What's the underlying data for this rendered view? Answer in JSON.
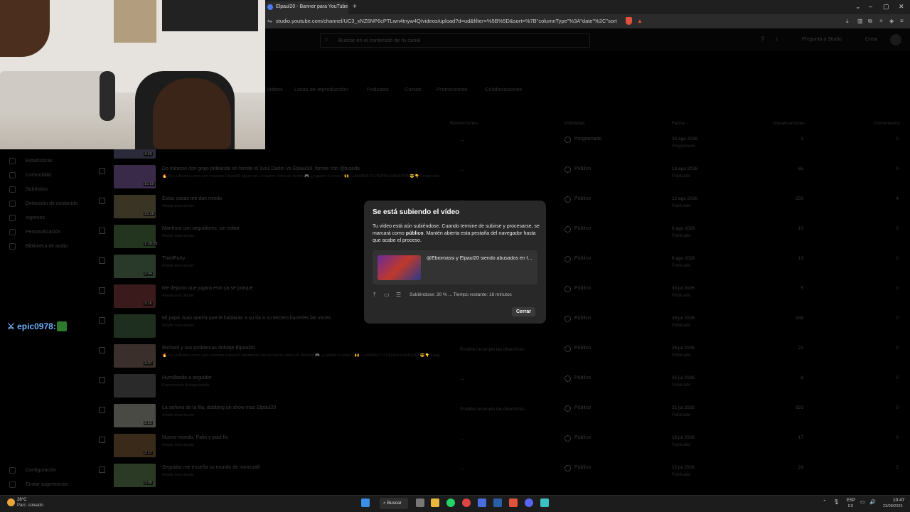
{
  "browser": {
    "tab_title": "Elpaul20 - Banner para YouTube",
    "url": "studio.youtube.com/channel/UC3_xNZ6NP6cPTLwn4tnyw4Q/videos/upload?d=ud&filter=%5B%5D&sort=%7B\"columnType\"%3A\"date\"%2C\"sortOrder\"%...",
    "new_tab": "+",
    "win_min": "–",
    "win_max": "▢",
    "win_close": "✕"
  },
  "studio_header": {
    "search_placeholder": "Buscar en el contenido de tu canal",
    "ask": "Pregunta a Studio",
    "create": "Crear"
  },
  "content_tabs": [
    "Videos",
    "Listas de reproducción",
    "Podcasts",
    "Cursos",
    "Promociones",
    "Colaboraciones"
  ],
  "sidebar": [
    {
      "label": "Estadísticas",
      "icon": "chart-icon"
    },
    {
      "label": "Comunidad",
      "icon": "community-icon"
    },
    {
      "label": "Subtítulos",
      "icon": "subtitles-icon"
    },
    {
      "label": "Detección de contenido",
      "icon": "copyright-icon"
    },
    {
      "label": "Ingresos",
      "icon": "money-icon"
    },
    {
      "label": "Personalización",
      "icon": "customize-icon"
    },
    {
      "label": "Biblioteca de audio",
      "icon": "audio-icon"
    }
  ],
  "sidebar_bottom": [
    {
      "label": "Configuración",
      "icon": "gear-icon"
    },
    {
      "label": "Enviar sugerencias",
      "icon": "feedback-icon"
    }
  ],
  "table_headers": {
    "restrictions": "Restricciones",
    "visibility": "Visibilidad",
    "date": "Fecha ↓",
    "views": "Visualizaciones",
    "comments": "Comentarios"
  },
  "rows": [
    {
      "title": "",
      "desc": "",
      "duration": "4:29",
      "restr": "—",
      "vis": "Programado",
      "date": "24 ago 2026",
      "status": "Programado",
      "views": "1",
      "comments": "0"
    },
    {
      "title": "Do minecio con grajo peleando en fornite el 1vs1 Darlin Vs Elpaul20, fornite con @tuzeda",
      "desc": "🔥 M-y-x Bueno como son vosotros Elpaul20 sigue con un nuevo vídeo de fornite 🎮 ¿y guzito e vosos? 🙌 LLAMADA TU PERRA HAVIERTA 😎👇 Luego esto más de juegos y secretos que se están buscando en. Vosotros no 👇",
      "duration": "10:59",
      "restr": "—",
      "vis": "Público",
      "date": "13 ago 2026",
      "status": "Publicado",
      "views": "65",
      "comments": "0"
    },
    {
      "title": "Estas casas me dan miedo",
      "desc": "Añadir descripción",
      "duration": "23:28",
      "restr": "—",
      "vis": "Público",
      "date": "12 ago 2026",
      "status": "Publicado",
      "views": "250",
      "comments": "4"
    },
    {
      "title": "Manhunt con seguidores, sin editar",
      "desc": "Añadir descripción",
      "duration": "1:28:25",
      "restr": "—",
      "vis": "Público",
      "date": "6 ago 2026",
      "status": "Publicado",
      "views": "10",
      "comments": "0"
    },
    {
      "title": "ThirdParty",
      "desc": "Añadir descripción",
      "duration": "2:04",
      "restr": "—",
      "vis": "Público",
      "date": "6 ago 2026",
      "status": "Publicado",
      "views": "13",
      "comments": "0"
    },
    {
      "title": "Me dejaron que jugara esto ya se porque",
      "desc": "Añadir descripción",
      "duration": "3:16",
      "restr": "—",
      "vis": "Público",
      "date": "30 jul 2026",
      "status": "Publicado",
      "views": "5",
      "comments": "0"
    },
    {
      "title": "Mi papá Juan quería que le hablaran a su tía a su tercero hacerles las voces",
      "desc": "Añadir descripción",
      "duration": "",
      "restr": "—",
      "vis": "Público",
      "date": "28 jul 2026",
      "status": "Publicado",
      "views": "249",
      "comments": "0"
    },
    {
      "title": "Richard y sus problemas doblaje Elpaul20",
      "desc": "🔥 M-y-x Bueno como son vosotros Elpaul20 aventuras con un nuevo vídeo en Richard 🎮 ¿y guzito e vosos? 🙌 LLAMADA TU PERRA HAVIERTA 😎👇 Luego esto más de juegos y secretos que se están buscando en. Vosotros no 👇",
      "duration": "3:07",
      "restr": "Posible incumple las directrices",
      "vis": "Público",
      "date": "26 jul 2026",
      "status": "Publicado",
      "views": "21",
      "comments": "0"
    },
    {
      "title": "Humillando a seguidor",
      "desc": "Experimento Autogenerado",
      "duration": "",
      "restr": "—",
      "vis": "Público",
      "date": "25 jul 2026",
      "status": "Publicado",
      "views": "8",
      "comments": "0"
    },
    {
      "title": "La señora de la fila, dubbing un show mas Elpaul20",
      "desc": "Añadir descripción",
      "duration": "3:52",
      "restr": "Posible incumple las directrices",
      "vis": "Público",
      "date": "21 jul 2026",
      "status": "Publicado",
      "views": "931",
      "comments": "0"
    },
    {
      "title": "Nuevo mundo, Palin y paul fiv",
      "desc": "Añadir descripción",
      "duration": "2:17",
      "restr": "—",
      "vis": "Público",
      "date": "16 jul 2026",
      "status": "Publicado",
      "views": "17",
      "comments": "0"
    },
    {
      "title": "Seguidor me enseña su mundo de minecraft",
      "desc": "Añadir descripción",
      "duration": "3:08",
      "restr": "—",
      "vis": "Público",
      "date": "15 jul 2026",
      "status": "Publicado",
      "views": "29",
      "comments": "2"
    }
  ],
  "overlay": {
    "chat_user": "epic0978:"
  },
  "dialog": {
    "title": "Se está subiendo el vídeo",
    "body_1": "Tu vídeo está aún subiéndose. Cuando termine de subirse y procesarse, se marcará como ",
    "body_bold": "público",
    "body_2": ". Mantén abierta esta pestaña del navegador hasta que acabe el proceso.",
    "video_title": "@Ebiomassi y Elpaul20 siendo abusados en f...",
    "progress": "Subiéndose: 20 % ... Tiempo restante: 16 minutos",
    "progress_value": 0.2,
    "close": "Cerrar"
  },
  "taskbar": {
    "temp": "28°C",
    "weather": "Parc. soleado",
    "search": "Buscar",
    "lang1": "ESP",
    "lang2": "ES",
    "time": "10:47",
    "date": "23/08/2026"
  }
}
